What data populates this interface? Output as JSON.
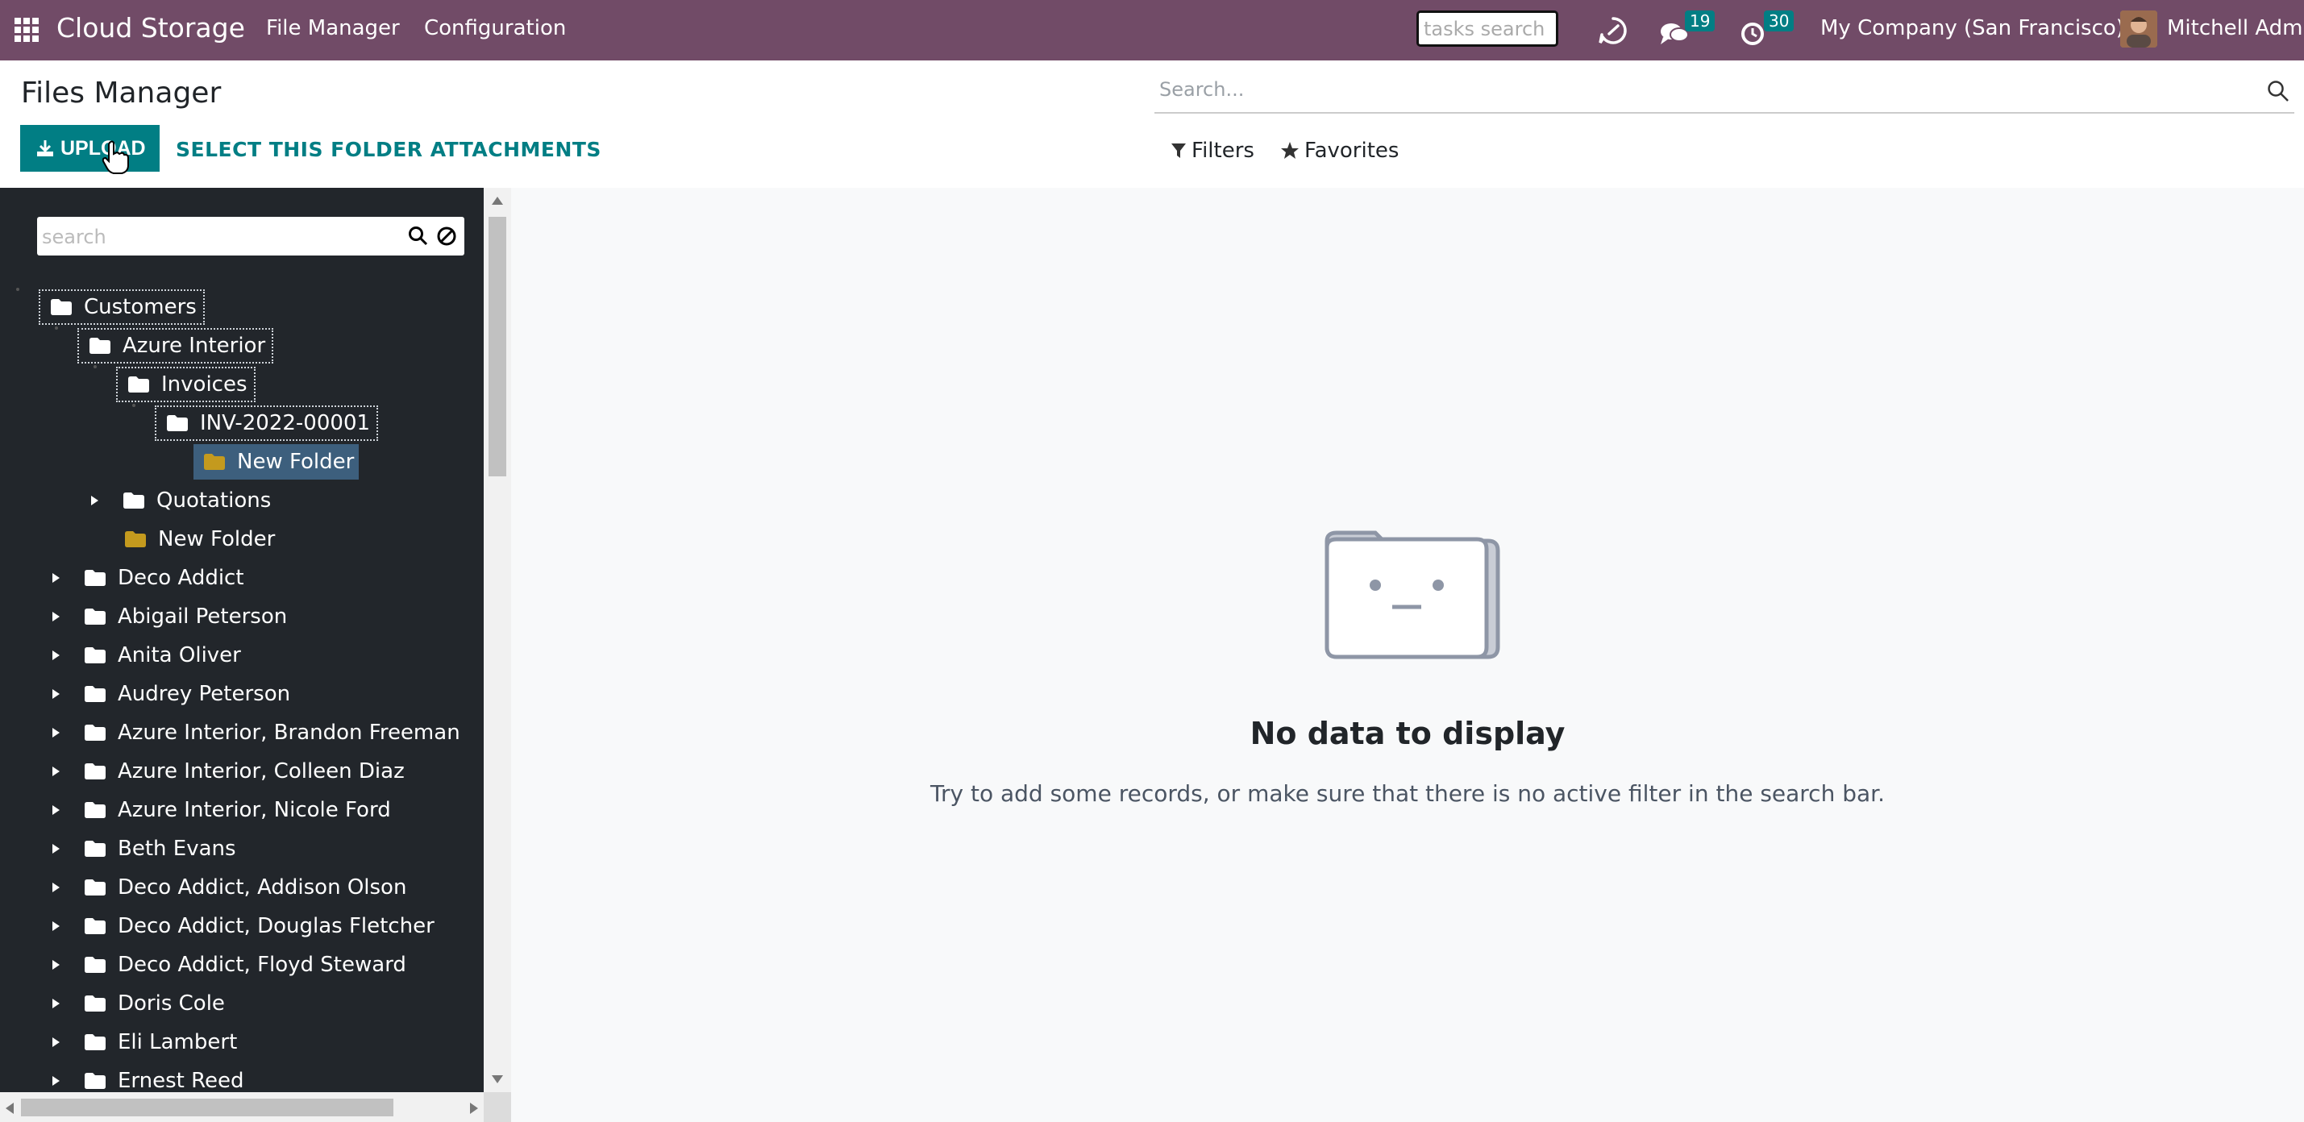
{
  "navbar": {
    "brand": "Cloud Storage",
    "menus": [
      "File Manager",
      "Configuration"
    ],
    "tasks_search_placeholder": "tasks search",
    "messages_count": "19",
    "activities_count": "30",
    "company": "My Company (San Francisco)",
    "user": "Mitchell Admin",
    "color": "#714b67"
  },
  "control": {
    "title": "Files Manager",
    "upload_label": "UPLOAD",
    "select_label": "SELECT THIS FOLDER ATTACHMENTS",
    "search_placeholder": "Search...",
    "filters_label": "Filters",
    "favorites_label": "Favorites",
    "accent": "#017e84"
  },
  "sidebar": {
    "search_placeholder": "search",
    "tree": [
      {
        "label": "Customers",
        "icon": "folder-icon"
      },
      {
        "label": "Azure Interior",
        "icon": "folder-icon"
      },
      {
        "label": "Invoices",
        "icon": "folder-icon"
      },
      {
        "label": "INV-2022-00001",
        "icon": "folder-icon"
      },
      {
        "label": "New Folder",
        "icon": "folder-icon",
        "selected": true
      },
      {
        "label": "Quotations",
        "icon": "folder-icon"
      },
      {
        "label": "New Folder",
        "icon": "folder-icon"
      },
      {
        "label": "Deco Addict",
        "icon": "folder-icon"
      },
      {
        "label": "Abigail Peterson",
        "icon": "folder-icon"
      },
      {
        "label": "Anita Oliver",
        "icon": "folder-icon"
      },
      {
        "label": "Audrey Peterson",
        "icon": "folder-icon"
      },
      {
        "label": "Azure Interior, Brandon Freeman",
        "icon": "folder-icon"
      },
      {
        "label": "Azure Interior, Colleen Diaz",
        "icon": "folder-icon"
      },
      {
        "label": "Azure Interior, Nicole Ford",
        "icon": "folder-icon"
      },
      {
        "label": "Beth Evans",
        "icon": "folder-icon"
      },
      {
        "label": "Deco Addict, Addison Olson",
        "icon": "folder-icon"
      },
      {
        "label": "Deco Addict, Douglas Fletcher",
        "icon": "folder-icon"
      },
      {
        "label": "Deco Addict, Floyd Steward",
        "icon": "folder-icon"
      },
      {
        "label": "Doris Cole",
        "icon": "folder-icon"
      },
      {
        "label": "Eli Lambert",
        "icon": "folder-icon"
      },
      {
        "label": "Ernest Reed",
        "icon": "folder-icon"
      }
    ]
  },
  "main": {
    "empty_title": "No data to display",
    "empty_help": "Try to add some records, or make sure that there is no active filter in the search bar."
  }
}
